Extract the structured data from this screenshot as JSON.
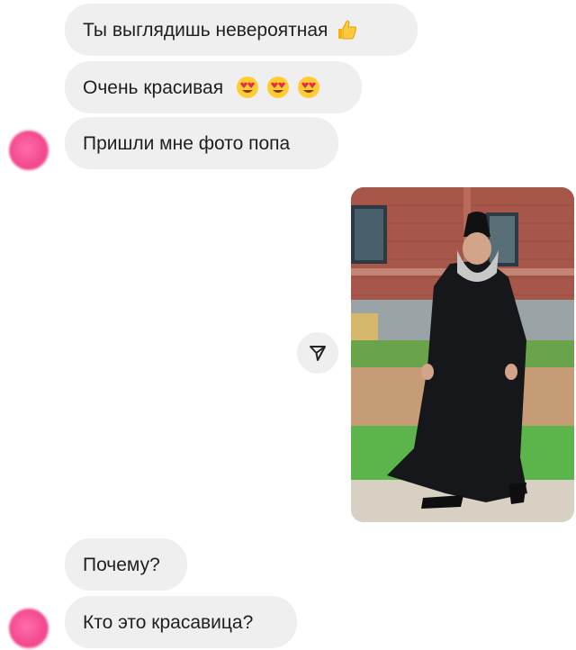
{
  "messages": [
    {
      "id": "m1",
      "text": "Ты выглядишь невероятная",
      "emoji": "thumbs-up-icon"
    },
    {
      "id": "m2",
      "text": "Очень красивая",
      "emoji": "heart-eyes-icon",
      "emoji_count": 3
    },
    {
      "id": "m3",
      "text": "Пришли мне фото попа"
    },
    {
      "id": "m4",
      "text": "Почему?"
    },
    {
      "id": "m5",
      "text": "Кто это красавица?"
    }
  ],
  "photo": {
    "subject": "priest-photo"
  },
  "share": {
    "icon": "share-icon"
  },
  "colors": {
    "bubble": "#efefef",
    "avatar": "#f2478e",
    "text": "#1f1f1f"
  }
}
